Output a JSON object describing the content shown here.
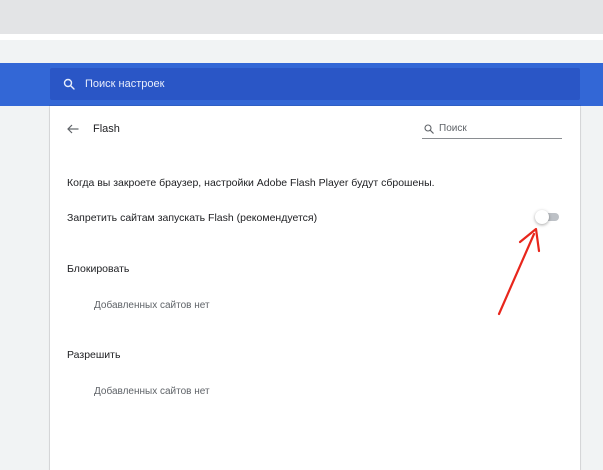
{
  "toolbar": {
    "search_placeholder": "Поиск настроек"
  },
  "subpage": {
    "title": "Flash",
    "search_placeholder": "Поиск",
    "info_text": "Когда вы закроете браузер, настройки Adobe Flash Player будут сброшены.",
    "block_toggle_label": "Запретить сайтам запускать Flash (рекомендуется)",
    "block_toggle_on": false,
    "sections": [
      {
        "title": "Блокировать",
        "empty_text": "Добавленных сайтов нет"
      },
      {
        "title": "Разрешить",
        "empty_text": "Добавленных сайтов нет"
      }
    ]
  },
  "colors": {
    "header": "#3367d6",
    "search_box": "#2a56c6",
    "annotation_arrow": "#e8261c"
  },
  "icons": {
    "search": "search-icon",
    "back": "arrow-back-icon"
  }
}
